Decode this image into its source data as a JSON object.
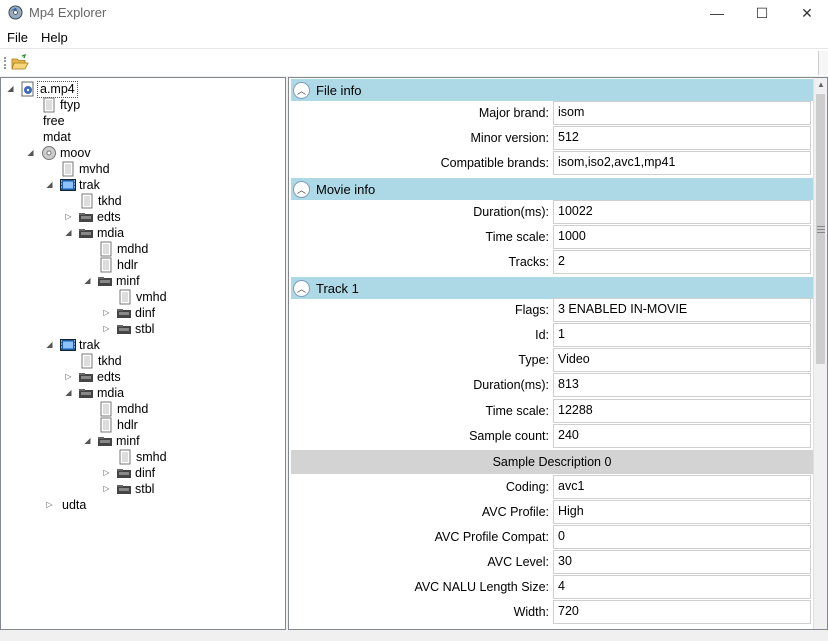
{
  "window": {
    "title": "Mp4 Explorer",
    "minimize": "—",
    "maximize": "☐",
    "close": "✕"
  },
  "menu": {
    "file": "File",
    "help": "Help"
  },
  "toolbar": {
    "open_icon": "open-folder-icon"
  },
  "tree": {
    "root": "a.mp4",
    "ftyp": "ftyp",
    "free": "free",
    "mdat": "mdat",
    "moov": "moov",
    "mvhd": "mvhd",
    "trak1": {
      "label": "trak",
      "tkhd": "tkhd",
      "edts": "edts",
      "mdia": "mdia",
      "mdhd": "mdhd",
      "hdlr": "hdlr",
      "minf": "minf",
      "mhd": "vmhd",
      "dinf": "dinf",
      "stbl": "stbl"
    },
    "trak2": {
      "label": "trak",
      "tkhd": "tkhd",
      "edts": "edts",
      "mdia": "mdia",
      "mdhd": "mdhd",
      "hdlr": "hdlr",
      "minf": "minf",
      "mhd": "smhd",
      "dinf": "dinf",
      "stbl": "stbl"
    },
    "udta": "udta"
  },
  "details": {
    "file_info": {
      "title": "File info",
      "rows": [
        {
          "label": "Major brand:",
          "value": "isom"
        },
        {
          "label": "Minor version:",
          "value": "512"
        },
        {
          "label": "Compatible brands:",
          "value": "isom,iso2,avc1,mp41"
        }
      ]
    },
    "movie_info": {
      "title": "Movie info",
      "rows": [
        {
          "label": "Duration(ms):",
          "value": "10022"
        },
        {
          "label": "Time scale:",
          "value": "1000"
        },
        {
          "label": "Tracks:",
          "value": "2"
        }
      ]
    },
    "track1": {
      "title": "Track 1",
      "rows": [
        {
          "label": "Flags:",
          "value": "3 ENABLED IN-MOVIE"
        },
        {
          "label": "Id:",
          "value": "1"
        },
        {
          "label": "Type:",
          "value": "Video"
        },
        {
          "label": "Duration(ms):",
          "value": "813"
        },
        {
          "label": "Time scale:",
          "value": "12288"
        },
        {
          "label": "Sample count:",
          "value": "240"
        }
      ],
      "sample_description": {
        "title": "Sample Description 0",
        "rows": [
          {
            "label": "Coding:",
            "value": "avc1"
          },
          {
            "label": "AVC Profile:",
            "value": "High"
          },
          {
            "label": "AVC Profile Compat:",
            "value": "0"
          },
          {
            "label": "AVC Level:",
            "value": "30"
          },
          {
            "label": "AVC NALU Length Size:",
            "value": "4"
          },
          {
            "label": "Width:",
            "value": "720"
          }
        ]
      }
    }
  }
}
